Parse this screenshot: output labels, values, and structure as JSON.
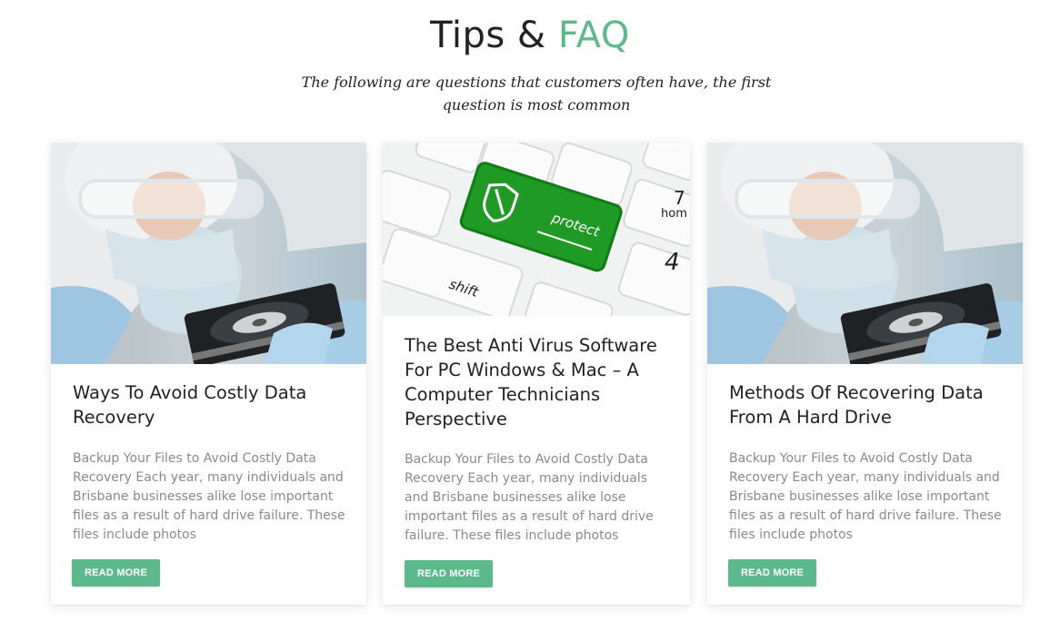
{
  "section": {
    "title_main": "Tips & ",
    "title_accent": "FAQ",
    "subtitle": "The following are questions that customers often have, the first question is most common"
  },
  "colors": {
    "accent": "#5bb98b",
    "text": "#222222",
    "muted": "#8a8a8a"
  },
  "cards": [
    {
      "image_icon": "technician-hard-drive-photo",
      "title": "Ways To Avoid Costly Data Recovery",
      "excerpt": "Backup Your Files to Avoid Costly Data Recovery Each year, many individuals and Brisbane businesses alike lose important files as a result of hard drive failure. These files include photos",
      "button": "READ MORE"
    },
    {
      "image_icon": "keyboard-protect-key-photo",
      "image_text": {
        "key_label": "protect",
        "shift": "shift",
        "num": "4",
        "num2": "7",
        "home": "hom"
      },
      "title": "The Best Anti Virus Software For PC Windows & Mac – A Computer Technicians Perspective",
      "excerpt": "Backup Your Files to Avoid Costly Data Recovery Each year, many individuals and Brisbane businesses alike lose important files as a result of hard drive failure. These files include photos",
      "button": "READ MORE"
    },
    {
      "image_icon": "technician-hard-drive-photo",
      "title": "Methods Of Recovering Data From A Hard Drive",
      "excerpt": "Backup Your Files to Avoid Costly Data Recovery Each year, many individuals and Brisbane businesses alike lose important files as a result of hard drive failure. These files include photos",
      "button": "READ MORE"
    }
  ]
}
